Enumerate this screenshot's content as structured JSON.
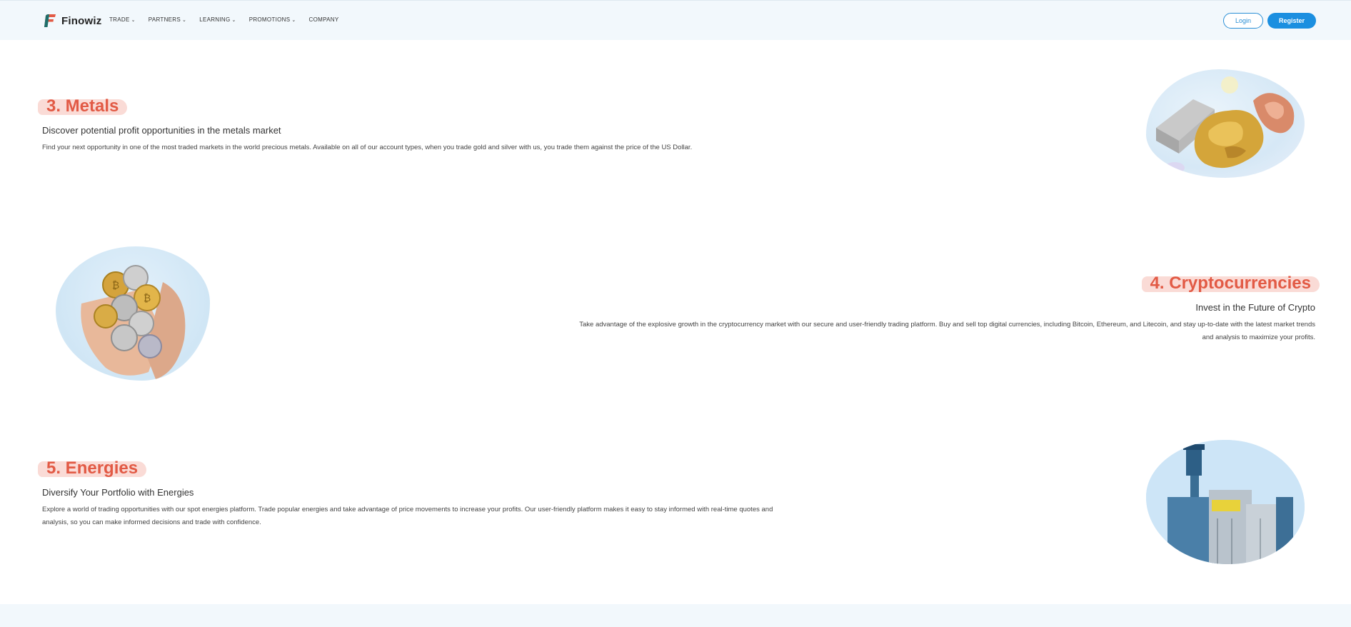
{
  "brand": {
    "name": "Finowiz",
    "accent": "#1b8fe0",
    "heading_color": "#e25a45"
  },
  "nav": {
    "items": [
      {
        "label": "TRADE",
        "dropdown": true
      },
      {
        "label": "PARTNERS",
        "dropdown": true
      },
      {
        "label": "LEARNING",
        "dropdown": true
      },
      {
        "label": "PROMOTIONS",
        "dropdown": true
      },
      {
        "label": "COMPANY",
        "dropdown": false
      }
    ],
    "login_label": "Login",
    "register_label": "Register"
  },
  "sections": {
    "metals": {
      "title": "3. Metals",
      "subtitle": "Discover potential profit opportunities in the metals market",
      "body": "Find your next opportunity in one of the most traded markets in the world precious metals. Available on all of our account types, when you trade gold and silver with us, you trade them against the price of the US Dollar.",
      "image_icon": "metal-bars-image"
    },
    "crypto": {
      "title": "4. Cryptocurrencies",
      "subtitle": "Invest in the Future of Crypto",
      "body_line1": "Take advantage of the explosive growth in the cryptocurrency market with our secure and user-friendly trading platform. Buy and sell top digital currencies, including Bitcoin, Ethereum, and Litecoin, and stay up-to-date with the latest market trends",
      "body_line2": "and analysis to maximize your profits.",
      "image_icon": "crypto-coins-image"
    },
    "energies": {
      "title": "5. Energies",
      "subtitle": "Diversify Your Portfolio with Energies",
      "body_line1": "Explore a world of trading opportunities with our spot energies platform. Trade popular energies and take advantage of price movements to increase your profits. Our user-friendly platform makes it easy to stay informed with real-time quotes and",
      "body_line2": "analysis, so you can make informed decisions and trade with confidence.",
      "image_icon": "energy-plant-image"
    }
  }
}
